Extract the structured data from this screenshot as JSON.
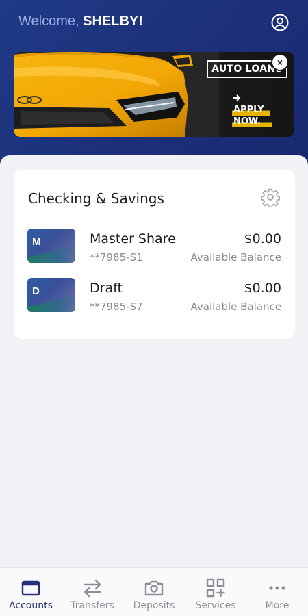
{
  "header": {
    "welcome_prefix": "Welcome,",
    "user_name": "SHELBY!"
  },
  "banner": {
    "title": "AUTO LOANS",
    "cta_line1": "APPLY",
    "cta_line2": "NOW.",
    "close_glyph": "×",
    "accent_color": "#e6b400"
  },
  "accounts_card": {
    "title": "Checking & Savings",
    "accounts": [
      {
        "letter": "M",
        "name": "Master Share",
        "number": "**7985-S1",
        "balance": "$0.00",
        "balance_label": "Available Balance"
      },
      {
        "letter": "D",
        "name": "Draft",
        "number": "**7985-S7",
        "balance": "$0.00",
        "balance_label": "Available Balance"
      }
    ]
  },
  "tabbar": {
    "tabs": [
      {
        "label": "Accounts",
        "icon": "wallet-icon",
        "active": true
      },
      {
        "label": "Transfers",
        "icon": "transfer-arrows-icon",
        "active": false
      },
      {
        "label": "Deposits",
        "icon": "camera-icon",
        "active": false
      },
      {
        "label": "Services",
        "icon": "grid-plus-icon",
        "active": false
      },
      {
        "label": "More",
        "icon": "more-dots-icon",
        "active": false
      }
    ]
  },
  "colors": {
    "brand_navy": "#1c2f78",
    "active_tab": "#24307a",
    "inactive_tab": "#8c8f9a"
  }
}
